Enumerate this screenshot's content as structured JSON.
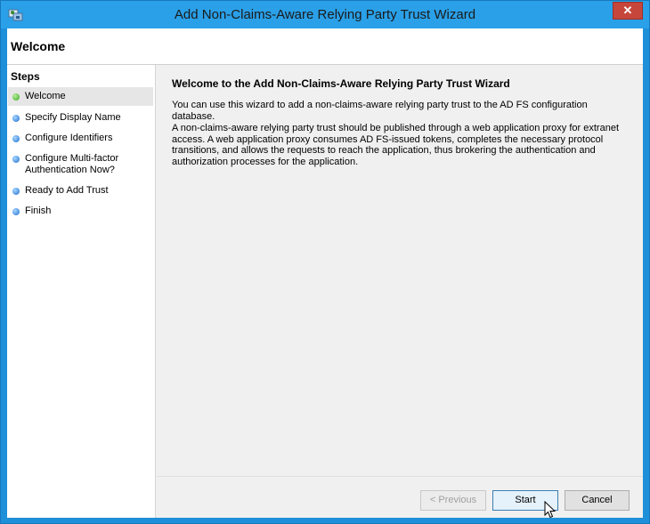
{
  "window": {
    "title": "Add Non-Claims-Aware Relying Party Trust Wizard",
    "close_label": "✕"
  },
  "header": {
    "title": "Welcome"
  },
  "steps": {
    "title": "Steps",
    "items": [
      {
        "label": "Welcome",
        "status": "current"
      },
      {
        "label": "Specify Display Name",
        "status": "pending"
      },
      {
        "label": "Configure Identifiers",
        "status": "pending"
      },
      {
        "label": "Configure Multi-factor Authentication Now?",
        "status": "pending"
      },
      {
        "label": "Ready to Add Trust",
        "status": "pending"
      },
      {
        "label": "Finish",
        "status": "pending"
      }
    ]
  },
  "content": {
    "title": "Welcome to the Add Non-Claims-Aware Relying Party Trust Wizard",
    "para1": "You can use this wizard to add a non-claims-aware relying party trust to the AD FS configuration database.",
    "para2": "A non-claims-aware relying party trust should be published through a web application proxy for extranet access. A web application proxy consumes AD FS-issued tokens, completes the necessary protocol transitions, and allows the requests to reach the application, thus brokering the authentication and authorization processes for the application."
  },
  "buttons": {
    "previous": "< Previous",
    "start": "Start",
    "cancel": "Cancel"
  }
}
